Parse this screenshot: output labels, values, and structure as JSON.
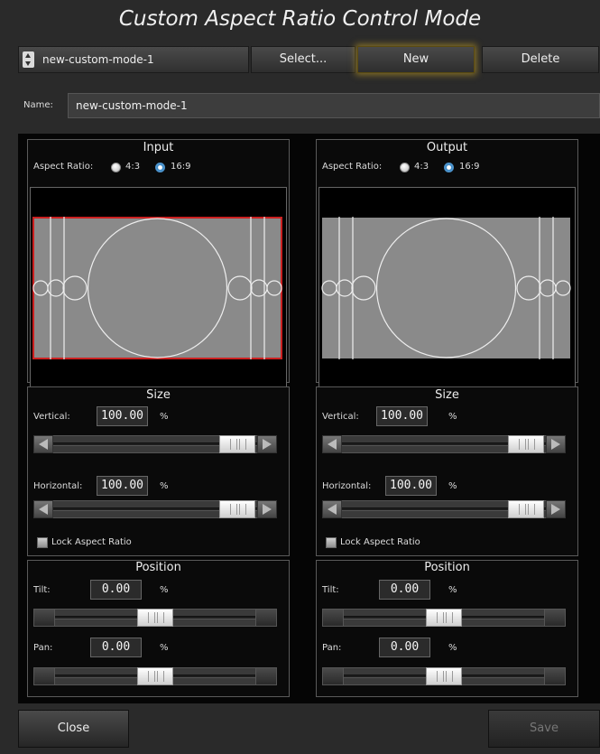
{
  "title": "Custom Aspect Ratio Control Mode",
  "toolbar": {
    "mode_value": "new-custom-mode-1",
    "select_label": "Select...",
    "new_label": "New",
    "delete_label": "Delete"
  },
  "name": {
    "label": "Name:",
    "value": "new-custom-mode-1"
  },
  "input": {
    "title": "Input",
    "aspect_label": "Aspect Ratio:",
    "option_43": "4:3",
    "option_169": "16:9",
    "selected": "16:9",
    "size_title": "Size",
    "vertical_label": "Vertical:",
    "vertical_value": "100.00",
    "vertical_percent": 100,
    "horizontal_label": "Horizontal:",
    "horizontal_value": "100.00",
    "horizontal_percent": 100,
    "pct": "%",
    "lock_label": "Lock Aspect Ratio",
    "position_title": "Position",
    "tilt_label": "Tilt:",
    "tilt_value": "0.00",
    "pan_label": "Pan:",
    "pan_value": "0.00"
  },
  "output": {
    "title": "Output",
    "aspect_label": "Aspect Ratio:",
    "option_43": "4:3",
    "option_169": "16:9",
    "selected": "16:9",
    "size_title": "Size",
    "vertical_label": "Vertical:",
    "vertical_value": "100.00",
    "vertical_percent": 100,
    "horizontal_label": "Horizontal:",
    "horizontal_value": "100.00",
    "horizontal_percent": 100,
    "pct": "%",
    "lock_label": "Lock Aspect Ratio",
    "position_title": "Position",
    "tilt_label": "Tilt:",
    "tilt_value": "0.00",
    "pan_label": "Pan:",
    "pan_value": "0.00"
  },
  "footer": {
    "close_label": "Close",
    "save_label": "Save"
  },
  "colors": {
    "accent_glow": "#d2aa28",
    "preview_fill": "#8a8a8a",
    "selection_border": "#cc2020",
    "radio_on": "#2c7fc0"
  }
}
